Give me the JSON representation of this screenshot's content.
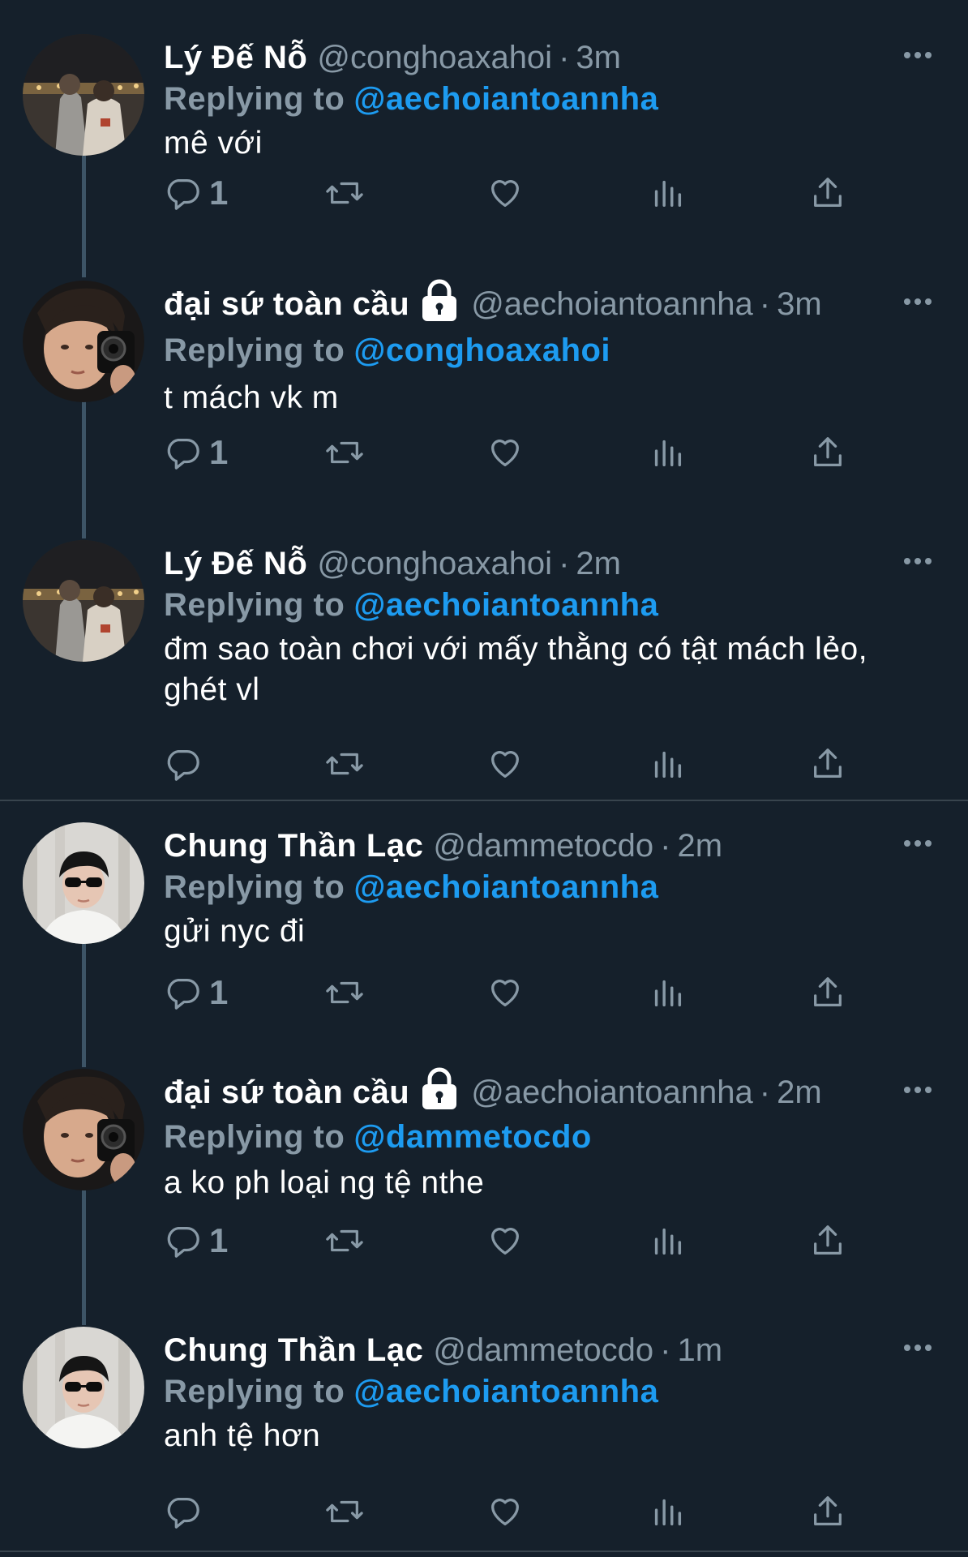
{
  "replying_prefix": "Replying to",
  "tweets": [
    {
      "name": "Lý Đế Nỗ",
      "handle": "@conghoaxahoi",
      "time": "3m",
      "replying_to": "@aechoiantoannha",
      "text": "mê với",
      "reply_count": "1",
      "avatar_icon": "couple-photo-avatar",
      "locked": false
    },
    {
      "name": "đại sứ toàn cầu",
      "handle": "@aechoiantoannha",
      "time": "3m",
      "replying_to": "@conghoaxahoi",
      "text": "t mách vk m",
      "reply_count": "1",
      "avatar_icon": "camera-selfie-avatar",
      "locked": true
    },
    {
      "name": "Lý Đế Nỗ",
      "handle": "@conghoaxahoi",
      "time": "2m",
      "replying_to": "@aechoiantoannha",
      "text": "đm sao toàn chơi với mấy thằng có tật mách lẻo, ghét vl",
      "reply_count": "",
      "avatar_icon": "couple-photo-avatar",
      "locked": false
    },
    {
      "name": "Chung Thần Lạc",
      "handle": "@dammetocdo",
      "time": "2m",
      "replying_to": "@aechoiantoannha",
      "text": "gửi nyc đi",
      "reply_count": "1",
      "avatar_icon": "sunglasses-avatar",
      "locked": false
    },
    {
      "name": "đại sứ toàn cầu",
      "handle": "@aechoiantoannha",
      "time": "2m",
      "replying_to": "@dammetocdo",
      "text": "a ko ph loại ng tệ nthe",
      "reply_count": "1",
      "avatar_icon": "camera-selfie-avatar",
      "locked": true
    },
    {
      "name": "Chung Thần Lạc",
      "handle": "@dammetocdo",
      "time": "1m",
      "replying_to": "@aechoiantoannha",
      "text": "anh tệ hơn",
      "reply_count": "",
      "avatar_icon": "sunglasses-avatar",
      "locked": false
    }
  ],
  "colors": {
    "background": "#15202b",
    "secondary_text": "#8899a6",
    "link": "#1d9bf0",
    "thread_line": "#3d5466",
    "divider": "#38444d"
  }
}
